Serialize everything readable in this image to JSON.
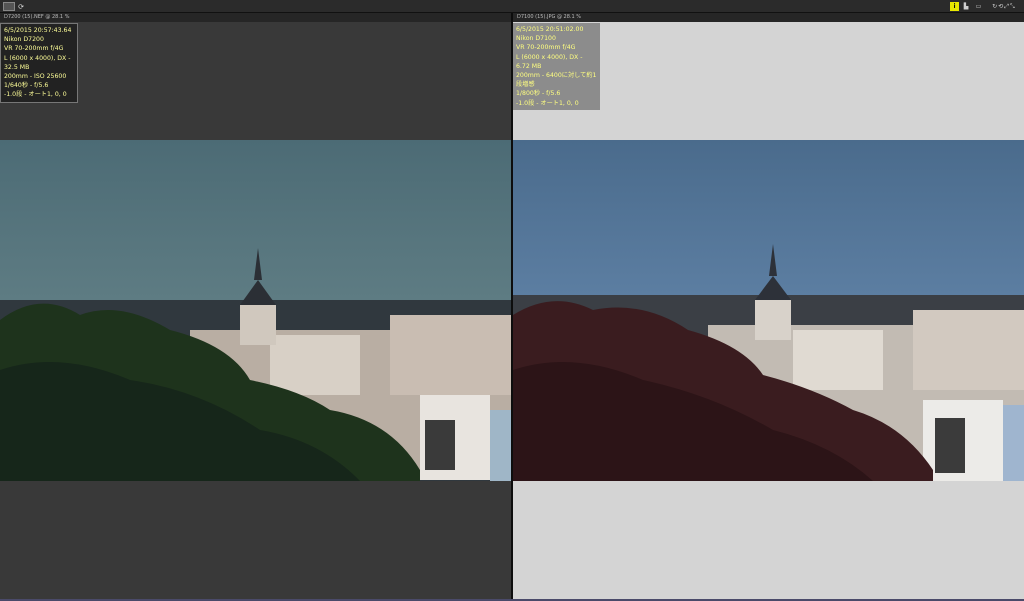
{
  "toolbar": {
    "grid_icon": "grid-icon",
    "refresh_icon": "refresh-icon",
    "info_label": "i"
  },
  "left": {
    "title": "D7200 (15).NEF @ 28.1 %",
    "info": [
      "6/5/2015 20:57:43.64",
      "Nikon D7200",
      "VR 70-200mm f/4G",
      "L (6000 x 4000), DX - 32.5 MB",
      "200mm - ISO 25600",
      "1/640秒 - f/5.6",
      "-1.0段 - オート1, 0, 0"
    ]
  },
  "right": {
    "title": "D7100 (15).JPG @ 28.1 %",
    "info": [
      "6/5/2015 20:51:02.00",
      "Nikon D7100",
      "VR 70-200mm f/4G",
      "L (6000 x 4000), DX - 6.72 MB",
      "200mm - 6400に対して約1段増感",
      "1/800秒 - f/5.6",
      "-1.0段 - オート1, 0, 0"
    ]
  },
  "colors": {
    "left_sky": "#4e6e7a",
    "right_sky": "#4d6f91",
    "left_trees": "#1c2f1a",
    "right_trees": "#3a1a1c"
  }
}
